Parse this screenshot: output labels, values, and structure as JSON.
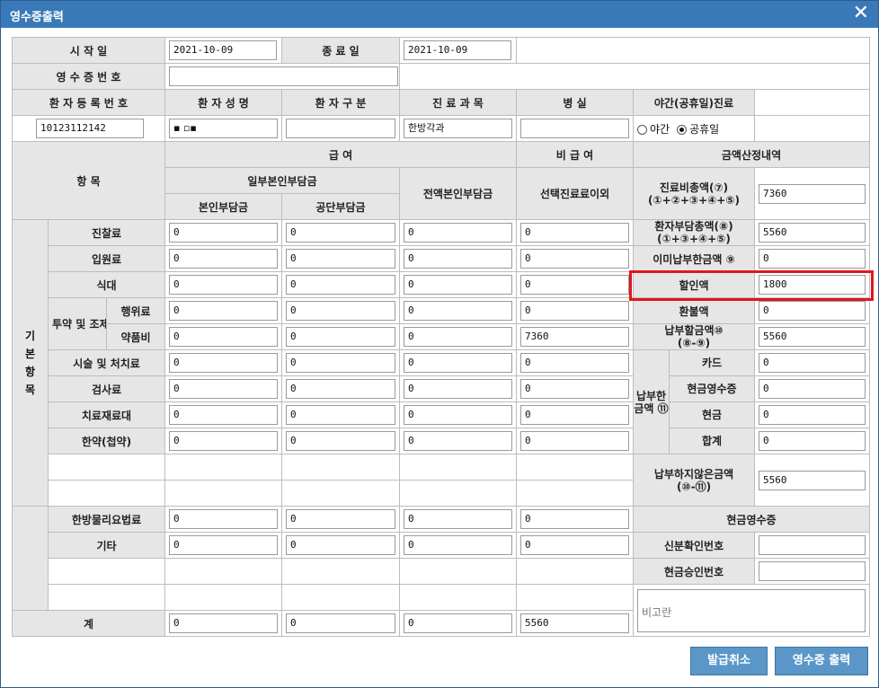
{
  "window": {
    "title": "영수증출력",
    "close_icon": "✕"
  },
  "labels": {
    "start_date": "시 작 일",
    "end_date": "종 료 일",
    "receipt_no": "영 수 증 번 호",
    "patient_reg_no": "환 자 등 록 번 호",
    "patient_name": "환 자 성 명",
    "patient_type": "환 자 구 분",
    "department": "진 료 과 목",
    "ward": "병 실",
    "night_holiday": "야간(공휴일)진료",
    "item": "항 목",
    "covered": "급 여",
    "non_covered": "비 급 여",
    "calc_detail": "금액산정내역",
    "partial_copay": "일부본인부담금",
    "self_pay": "본인부담금",
    "public_pay": "공단부담금",
    "full_self_pay": "전액본인부담금",
    "optional_care": "선택진료료이외",
    "basic_items": "기 본 항 목",
    "drug_prep": "투약 및 조제료",
    "cash_receipt_section": "현금영수증",
    "total": "계"
  },
  "fields": {
    "start_date": "2021-10-09",
    "end_date": "2021-10-09",
    "receipt_no": "",
    "patient_reg_no": "10123112142",
    "patient_name": "▪ ▫▪",
    "patient_type": "",
    "department": "한방각과",
    "ward": ""
  },
  "radio": {
    "night": "야간",
    "holiday": "공휴일",
    "selected": "holiday"
  },
  "items": [
    {
      "label": "진찰료",
      "v": [
        "0",
        "0",
        "0",
        "0"
      ]
    },
    {
      "label": "입원료",
      "v": [
        "0",
        "0",
        "0",
        "0"
      ]
    },
    {
      "label": "식대",
      "v": [
        "0",
        "0",
        "0",
        "0"
      ]
    },
    {
      "label": "행위료",
      "v": [
        "0",
        "0",
        "0",
        "0"
      ]
    },
    {
      "label": "약품비",
      "v": [
        "0",
        "0",
        "0",
        "7360"
      ]
    },
    {
      "label": "시술 및 처치료",
      "v": [
        "0",
        "0",
        "0",
        "0"
      ]
    },
    {
      "label": "검사료",
      "v": [
        "0",
        "0",
        "0",
        "0"
      ]
    },
    {
      "label": "치료재료대",
      "v": [
        "0",
        "0",
        "0",
        "0"
      ]
    },
    {
      "label": "한약(첩약)",
      "v": [
        "0",
        "0",
        "0",
        "0"
      ]
    },
    {
      "label": "한방물리요법료",
      "v": [
        "0",
        "0",
        "0",
        "0"
      ]
    },
    {
      "label": "기타",
      "v": [
        "0",
        "0",
        "0",
        "0"
      ]
    }
  ],
  "totals": [
    "0",
    "0",
    "0",
    "5560"
  ],
  "calc": {
    "total_medical": {
      "label": "진료비총액(⑦)\n(①+②+③+④+⑤)",
      "value": "7360"
    },
    "patient_total": {
      "label": "환자부담총액(⑧)\n(①+③+④+⑤)",
      "value": "5560"
    },
    "already_paid": {
      "label": "이미납부한금액 ⑨",
      "value": "0"
    },
    "discount": {
      "label": "할인액",
      "value": "1800"
    },
    "refund": {
      "label": "환불액",
      "value": "0"
    },
    "amount_due": {
      "label": "납부할금액⑩\n(⑧-⑨)",
      "value": "5560"
    },
    "paid_group": "납부한 금액 ⑪",
    "card": {
      "label": "카드",
      "value": "0"
    },
    "cash_receipt": {
      "label": "현금영수증",
      "value": "0"
    },
    "cash": {
      "label": "현금",
      "value": "0"
    },
    "sum": {
      "label": "합계",
      "value": "0"
    },
    "unpaid": {
      "label": "납부하지않은금액\n(⑩-⑪)",
      "value": "5560"
    },
    "id_no": {
      "label": "신분확인번호",
      "value": ""
    },
    "approval_no": {
      "label": "현금승인번호",
      "value": ""
    },
    "remarks": "비고란"
  },
  "buttons": {
    "cancel": "발급취소",
    "print": "영수증 출력"
  },
  "colors": {
    "titlebar": "#3a79b8",
    "button": "#5a97c8",
    "highlight": "#e0161e",
    "label_bg": "#e6e6e6"
  }
}
